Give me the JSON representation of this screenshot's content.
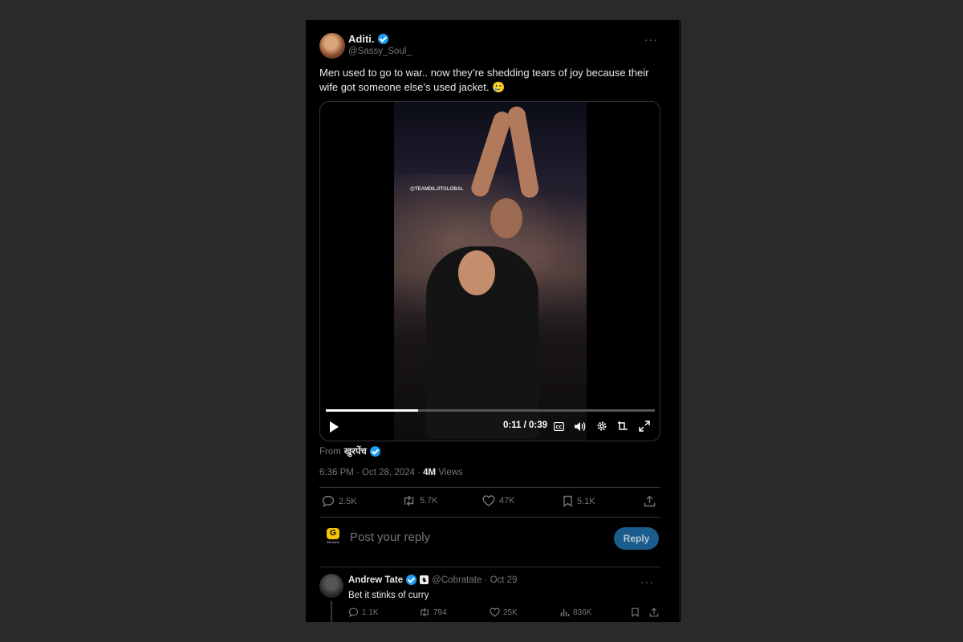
{
  "post": {
    "author_name": "Aditi.",
    "author_handle": "@Sassy_Soul_",
    "more_label": "···",
    "text": "Men used to go to war.. now they’re shedding tears of joy because their wife got someone else’s used jacket. 🥲",
    "video": {
      "watermark": "@TEAMDILJITGLOBAL",
      "time_display": "0:11 / 0:39",
      "progress": 0.28
    },
    "from_label": "From",
    "from_name": "खुरपेंच",
    "timestamp": "6:36 PM · Oct 28, 2024 ·",
    "views_count": "4M",
    "views_label": "Views",
    "stats": {
      "replies": "2.5K",
      "reposts": "5.7K",
      "likes": "47K",
      "bookmarks": "5.1K"
    }
  },
  "compose": {
    "placeholder": "Post your reply",
    "button_label": "Reply",
    "avatar_logo": "G",
    "avatar_sub": "Bhi Ashe"
  },
  "reply": {
    "name": "Andrew Tate",
    "handle_date": "@Cobratate · Oct 29",
    "text": "Bet it stinks of curry",
    "more_label": "···",
    "stats": {
      "replies": "1.1K",
      "reposts": "794",
      "likes": "25K",
      "views": "836K"
    }
  },
  "colors": {
    "background": "#000000",
    "accent": "#1d9bf0",
    "muted": "#71767b",
    "text": "#e7e9ea"
  }
}
